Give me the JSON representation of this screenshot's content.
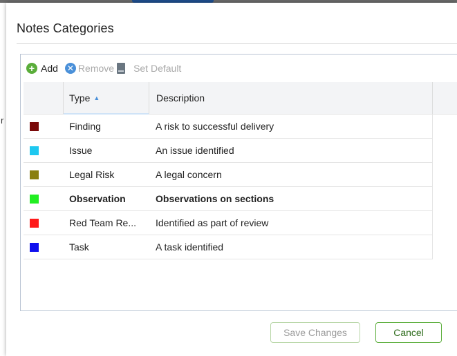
{
  "background": {
    "left_fragment": "r"
  },
  "dialog": {
    "title": "Notes Categories"
  },
  "toolbar": {
    "add_label": "Add",
    "remove_label": "Remove",
    "set_default_label": "Set Default"
  },
  "grid": {
    "columns": {
      "type": "Type",
      "description": "Description"
    },
    "sort": {
      "column": "Type",
      "direction": "ascending"
    },
    "rows": [
      {
        "color": "#7a0a0a",
        "type": "Finding",
        "description": "A risk to successful delivery",
        "bold": false
      },
      {
        "color": "#1ec8f0",
        "type": "Issue",
        "description": "An issue identified",
        "bold": false
      },
      {
        "color": "#8a7f10",
        "type": "Legal Risk",
        "description": "A legal concern",
        "bold": false
      },
      {
        "color": "#22ee22",
        "type": "Observation",
        "description": "Observations on sections",
        "bold": true
      },
      {
        "color": "#ff1a1a",
        "type": "Red Team Re...",
        "description": "Identified as part of review",
        "bold": false
      },
      {
        "color": "#1010ee",
        "type": "Task",
        "description": "A task identified",
        "bold": false
      }
    ]
  },
  "footer": {
    "save_label": "Save Changes",
    "cancel_label": "Cancel"
  }
}
